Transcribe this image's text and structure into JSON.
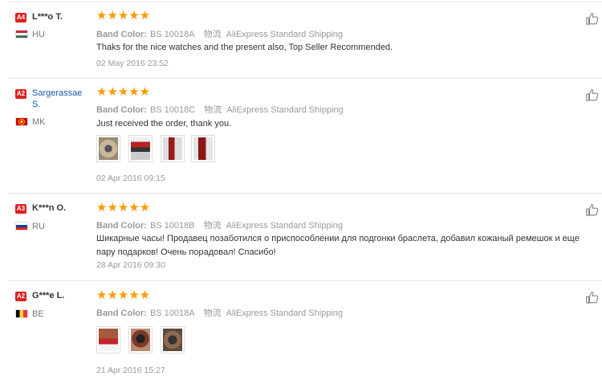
{
  "reviews": [
    {
      "level": "A4",
      "level_color": "#e02020",
      "username": "L***o T.",
      "country_code": "HU",
      "flag_colors": [
        "#ce2939",
        "#ffffff",
        "#477050"
      ],
      "stars": "★★★★★",
      "band_color_label": "Band Color:",
      "band_color_value": "BS 10018A",
      "shipping_label": "物流",
      "shipping_value": "AliExpress Standard Shipping",
      "text": "Thaks for the nice watches and the present also, Top Seller Recommended.",
      "date": "02 May 2016 23:52",
      "photos": []
    },
    {
      "level": "A2",
      "level_color": "#e02020",
      "username": "Sargerassae S.",
      "country_code": "MK",
      "flag_colors": [
        "#d20000",
        "#ffe600"
      ],
      "stars": "★★★★★",
      "band_color_label": "Band Color:",
      "band_color_value": "BS 10018C",
      "shipping_label": "物流",
      "shipping_value": "AliExpress Standard Shipping",
      "text": "Just received the order, thank you.",
      "date": "02 Apr 2016 09:15",
      "photos": [
        "watch-photo-1",
        "watch-photo-2",
        "watch-photo-3",
        "watch-photo-4"
      ]
    },
    {
      "level": "A3",
      "level_color": "#e02020",
      "username": "K***n O.",
      "country_code": "RU",
      "flag_colors": [
        "#ffffff",
        "#0039a6",
        "#d52b1e"
      ],
      "stars": "★★★★★",
      "band_color_label": "Band Color:",
      "band_color_value": "BS 10018B",
      "shipping_label": "物流",
      "shipping_value": "AliExpress Standard Shipping",
      "text": "Шикарные часы! Продавец позаботился о приспособлении для подгонки браслета, добавил кожаный ремешок и еще пару подарков! Очень порадовал! Спасибо!",
      "date": "28 Apr 2016 09:30",
      "photos": []
    },
    {
      "level": "A2",
      "level_color": "#e02020",
      "username": "G***e L.",
      "country_code": "BE",
      "flag_colors": [
        "#000000",
        "#fdda24",
        "#ef3340"
      ],
      "stars": "★★★★★",
      "band_color_label": "Band Color:",
      "band_color_value": "BS 10018A",
      "shipping_label": "物流",
      "shipping_value": "AliExpress Standard Shipping",
      "text": "",
      "date": "21 Apr 2016 15:27",
      "photos": [
        "watch-photo-1",
        "watch-photo-2",
        "watch-photo-3"
      ]
    }
  ],
  "icons": {
    "like": "thumbs-up-icon"
  }
}
